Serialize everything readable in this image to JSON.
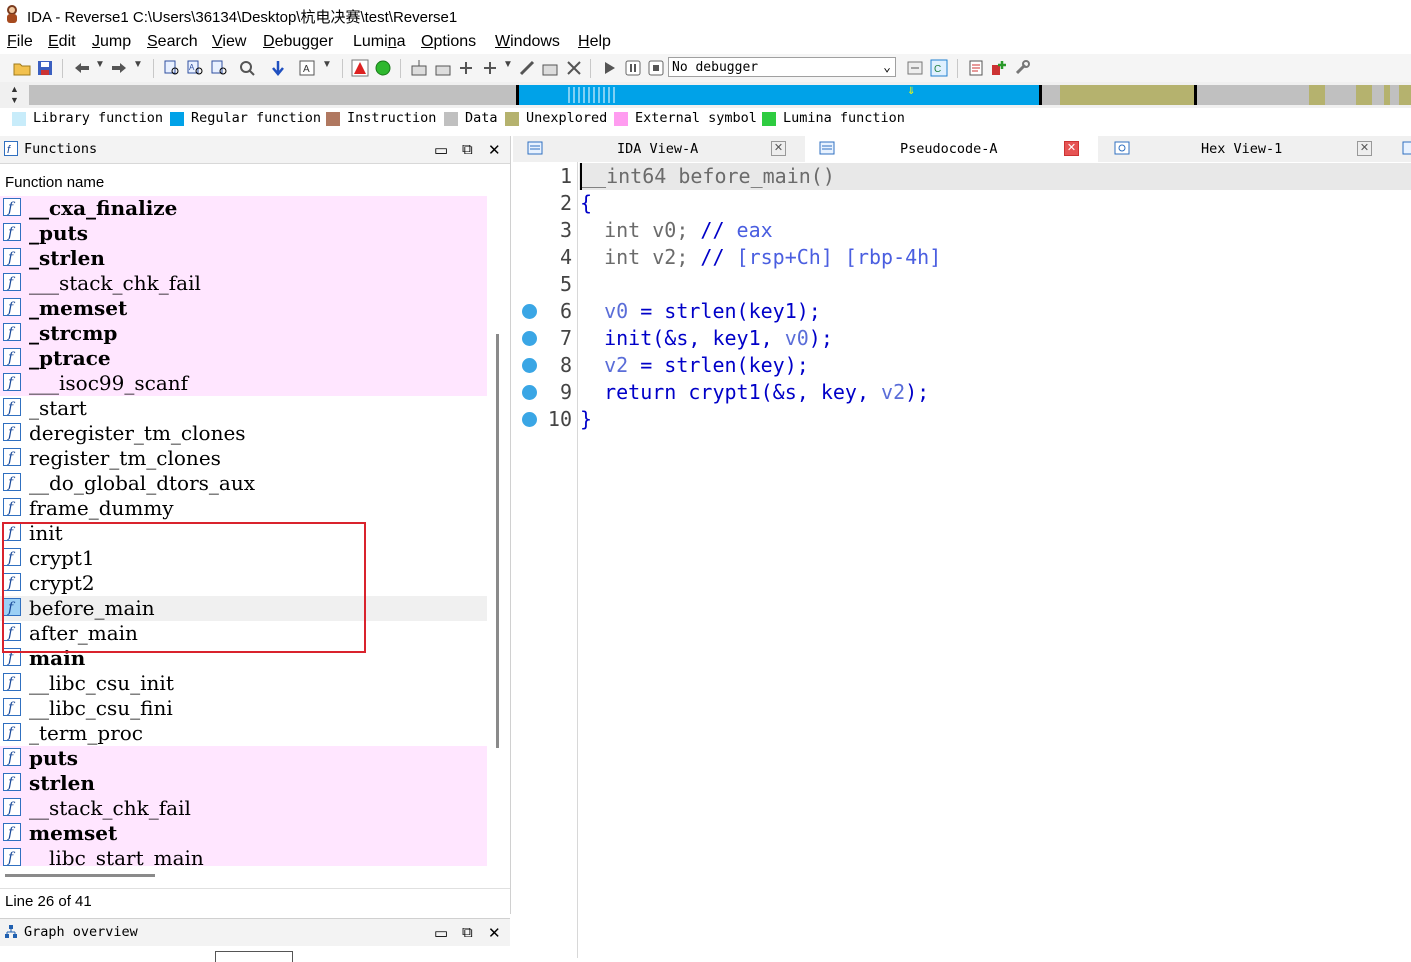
{
  "window": {
    "title": "IDA - Reverse1 C:\\Users\\36134\\Desktop\\杭电决赛\\test\\Reverse1"
  },
  "menu": [
    {
      "label": "File",
      "u": "F",
      "rest": "ile"
    },
    {
      "label": "Edit",
      "u": "E",
      "rest": "dit"
    },
    {
      "label": "Jump",
      "u": "J",
      "rest": "ump"
    },
    {
      "label": "Search",
      "u": "S",
      "rest": "earch"
    },
    {
      "label": "View",
      "u": "V",
      "rest": "iew"
    },
    {
      "label": "Debugger",
      "u": "D",
      "rest": "ebugger"
    },
    {
      "label": "Lumina",
      "pre": "Lumi",
      "u": "n",
      "rest": "a"
    },
    {
      "label": "Options",
      "u": "O",
      "rest": "ptions"
    },
    {
      "label": "Windows",
      "u": "W",
      "rest": "indows"
    },
    {
      "label": "Help",
      "u": "H",
      "rest": "elp"
    }
  ],
  "toolbar": {
    "debugger_value": "No debugger"
  },
  "legend": [
    {
      "label": "Library function",
      "color": "#c8ecfa"
    },
    {
      "label": "Regular function",
      "color": "#00a2e8"
    },
    {
      "label": "Instruction",
      "color": "#b07860"
    },
    {
      "label": "Data",
      "color": "#c0c0c0"
    },
    {
      "label": "Unexplored",
      "color": "#b5b26e"
    },
    {
      "label": "External symbol",
      "color": "#ff9cf0"
    },
    {
      "label": "Lumina function",
      "color": "#2ecc40"
    }
  ],
  "functions_panel": {
    "title": "Functions",
    "column_header": "Function name",
    "status": "Line 26 of 41",
    "items": [
      {
        "name": "__cxa_finalize",
        "bold": true,
        "ext": true
      },
      {
        "name": "_puts",
        "bold": true,
        "ext": true
      },
      {
        "name": "_strlen",
        "bold": true,
        "ext": true
      },
      {
        "name": "___stack_chk_fail",
        "bold": false,
        "ext": true
      },
      {
        "name": "_memset",
        "bold": true,
        "ext": true
      },
      {
        "name": "_strcmp",
        "bold": true,
        "ext": true
      },
      {
        "name": "_ptrace",
        "bold": true,
        "ext": true
      },
      {
        "name": "___isoc99_scanf",
        "bold": false,
        "ext": true
      },
      {
        "name": "_start",
        "bold": false,
        "ext": false
      },
      {
        "name": "deregister_tm_clones",
        "bold": false,
        "ext": false
      },
      {
        "name": "register_tm_clones",
        "bold": false,
        "ext": false
      },
      {
        "name": "__do_global_dtors_aux",
        "bold": false,
        "ext": false
      },
      {
        "name": "frame_dummy",
        "bold": false,
        "ext": false
      },
      {
        "name": "init",
        "bold": false,
        "ext": false
      },
      {
        "name": "crypt1",
        "bold": false,
        "ext": false
      },
      {
        "name": "crypt2",
        "bold": false,
        "ext": false
      },
      {
        "name": "before_main",
        "bold": false,
        "ext": false,
        "selected": true
      },
      {
        "name": "after_main",
        "bold": false,
        "ext": false
      },
      {
        "name": "main",
        "bold": true,
        "ext": false
      },
      {
        "name": "__libc_csu_init",
        "bold": false,
        "ext": false
      },
      {
        "name": "__libc_csu_fini",
        "bold": false,
        "ext": false
      },
      {
        "name": "_term_proc",
        "bold": false,
        "ext": false
      },
      {
        "name": "puts",
        "bold": true,
        "ext": true
      },
      {
        "name": "strlen",
        "bold": true,
        "ext": true
      },
      {
        "name": "__stack_chk_fail",
        "bold": false,
        "ext": true
      },
      {
        "name": "memset",
        "bold": true,
        "ext": true
      },
      {
        "name": "__libc_start_main",
        "bold": false,
        "ext": true
      }
    ]
  },
  "graph_panel": {
    "title": "Graph overview"
  },
  "tabs": [
    {
      "label": "IDA View-A",
      "active": false
    },
    {
      "label": "Pseudocode-A",
      "active": true
    },
    {
      "label": "Hex View-1",
      "active": false
    }
  ],
  "pseudocode": [
    {
      "num": "1",
      "bp": false,
      "tokens": [
        [
          "k",
          "__int64 before_main()"
        ]
      ]
    },
    {
      "num": "2",
      "bp": false,
      "tokens": [
        [
          "bl",
          "{"
        ]
      ]
    },
    {
      "num": "3",
      "bp": false,
      "tokens": [
        [
          "k",
          "  int v0; "
        ],
        [
          "bl",
          "// "
        ],
        [
          "cmt",
          "eax"
        ]
      ]
    },
    {
      "num": "4",
      "bp": false,
      "tokens": [
        [
          "k",
          "  int v2; "
        ],
        [
          "bl",
          "// "
        ],
        [
          "cmt",
          "[rsp+Ch] [rbp-4h]"
        ]
      ]
    },
    {
      "num": "5",
      "bp": false,
      "tokens": []
    },
    {
      "num": "6",
      "bp": true,
      "tokens": [
        [
          "k",
          "  "
        ],
        [
          "lv",
          "v0"
        ],
        [
          "bl",
          " = strlen(key1);"
        ]
      ]
    },
    {
      "num": "7",
      "bp": true,
      "tokens": [
        [
          "bl",
          "  init(&s, key1, "
        ],
        [
          "lv",
          "v0"
        ],
        [
          "bl",
          ");"
        ]
      ]
    },
    {
      "num": "8",
      "bp": true,
      "tokens": [
        [
          "k",
          "  "
        ],
        [
          "lv",
          "v2"
        ],
        [
          "bl",
          " = strlen(key);"
        ]
      ]
    },
    {
      "num": "9",
      "bp": true,
      "tokens": [
        [
          "bl",
          "  return crypt1(&s, key, "
        ],
        [
          "lv",
          "v2"
        ],
        [
          "bl",
          ");"
        ]
      ]
    },
    {
      "num": "10",
      "bp": true,
      "tokens": [
        [
          "bl",
          "}"
        ]
      ]
    }
  ]
}
